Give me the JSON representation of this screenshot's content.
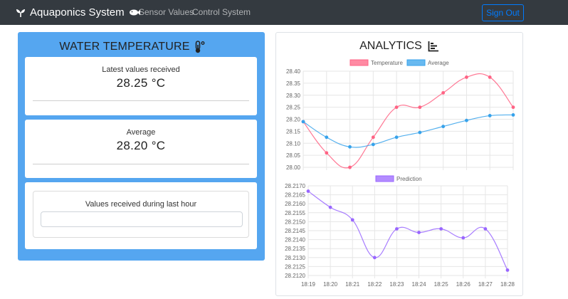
{
  "nav": {
    "brand": "Aquaponics System",
    "links": [
      "Sensor Values",
      "Control System"
    ],
    "signout": "Sign Out"
  },
  "water": {
    "title": "WATER TEMPERATURE",
    "latest_label": "Latest values received",
    "latest_value": "28.25 °C",
    "average_label": "Average",
    "average_value": "28.20 °C",
    "hour_label": "Values received during last hour"
  },
  "analytics": {
    "title": "ANALYTICS"
  },
  "colors": {
    "navbar": "#343a40",
    "panel": "#55a6f0",
    "temperature": "#ff6384",
    "average": "#36a2eb",
    "prediction": "#9966ff"
  },
  "chart_data": [
    {
      "type": "line",
      "title": "",
      "xlabel": "",
      "ylabel": "",
      "x": [
        1,
        2,
        3,
        4,
        5,
        6,
        7,
        8,
        9,
        10
      ],
      "ylim": [
        28.0,
        28.4
      ],
      "yticks": [
        "28.40",
        "28.35",
        "28.30",
        "28.25",
        "28.20",
        "28.15",
        "28.10",
        "28.05",
        "28.00"
      ],
      "legend": "top",
      "grid": true,
      "series": [
        {
          "name": "Temperature",
          "color": "#ff6384",
          "values": [
            28.19,
            28.06,
            28.0,
            28.125,
            28.25,
            28.25,
            28.31,
            28.375,
            28.375,
            28.25
          ]
        },
        {
          "name": "Average",
          "color": "#36a2eb",
          "values": [
            28.19,
            28.125,
            28.085,
            28.095,
            28.125,
            28.145,
            28.17,
            28.195,
            28.215,
            28.218
          ]
        }
      ]
    },
    {
      "type": "line",
      "title": "",
      "xlabel": "",
      "ylabel": "",
      "categories": [
        "18:19",
        "18:20",
        "18:21",
        "18:22",
        "18:23",
        "18:24",
        "18:25",
        "18:26",
        "18:27",
        "18:28"
      ],
      "ylim": [
        28.212,
        28.217
      ],
      "yticks": [
        "28.2170",
        "28.2165",
        "28.2160",
        "28.2155",
        "28.2150",
        "28.2145",
        "28.2140",
        "28.2135",
        "28.2130",
        "28.2125",
        "28.2120"
      ],
      "legend": "top",
      "grid": true,
      "series": [
        {
          "name": "Prediction",
          "color": "#9966ff",
          "values": [
            28.2167,
            28.2158,
            28.2151,
            28.213,
            28.2146,
            28.2144,
            28.2146,
            28.2141,
            28.2146,
            28.2123
          ]
        }
      ]
    }
  ]
}
